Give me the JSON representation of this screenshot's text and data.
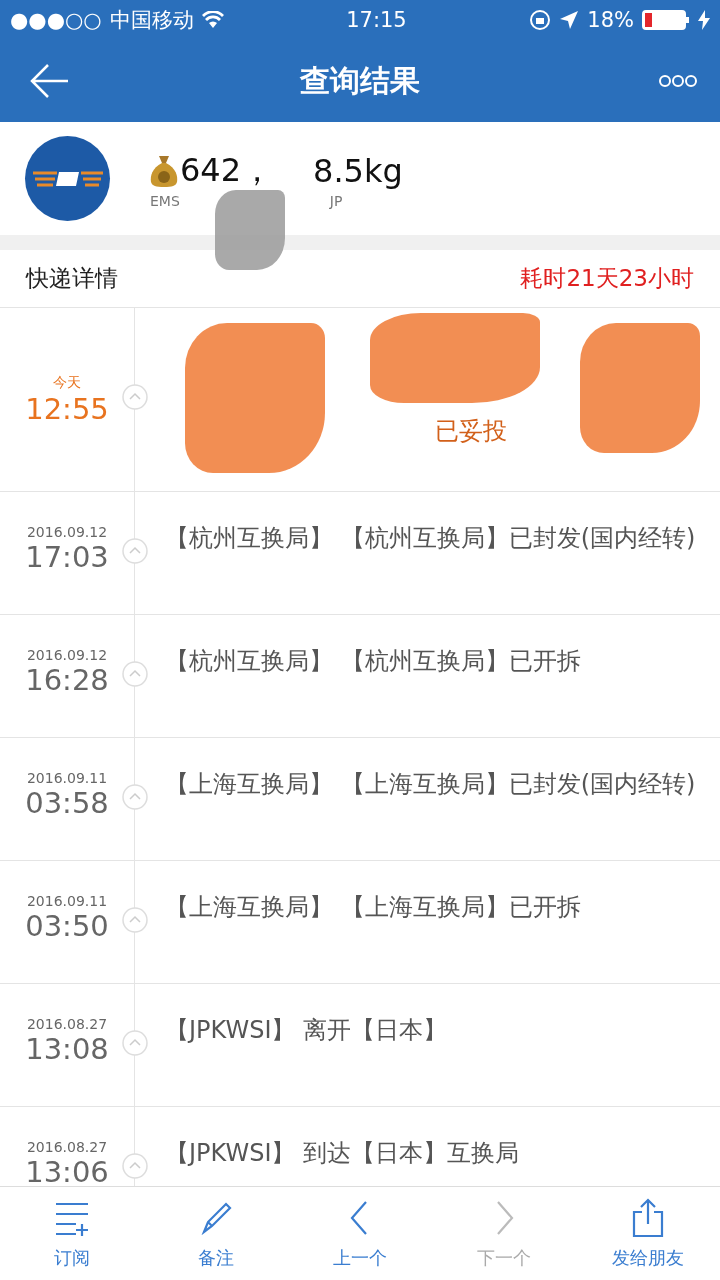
{
  "status_bar": {
    "signal_dots": "●●●○○",
    "carrier": "中国移动",
    "time": "17:15",
    "battery": "18%"
  },
  "nav": {
    "title": "查询结果"
  },
  "package": {
    "price": "642，",
    "weight": "8.5kg",
    "code_start": "EMS",
    "code_end": "JP"
  },
  "section": {
    "title": "快递详情",
    "elapsed": "耗时21天23小时"
  },
  "events": [
    {
      "date": "今天",
      "time": "12:55",
      "text": "已妥投",
      "latest": true
    },
    {
      "date": "2016.09.12",
      "time": "17:03",
      "text": "【杭州互换局】 【杭州互换局】已封发(国内经转)",
      "latest": false
    },
    {
      "date": "2016.09.12",
      "time": "16:28",
      "text": "【杭州互换局】 【杭州互换局】已开拆",
      "latest": false
    },
    {
      "date": "2016.09.11",
      "time": "03:58",
      "text": "【上海互换局】 【上海互换局】已封发(国内经转)",
      "latest": false
    },
    {
      "date": "2016.09.11",
      "time": "03:50",
      "text": "【上海互换局】 【上海互换局】已开拆",
      "latest": false
    },
    {
      "date": "2016.08.27",
      "time": "13:08",
      "text": "【JPKWSI】 离开【日本】",
      "latest": false
    },
    {
      "date": "2016.08.27",
      "time": "13:06",
      "text": "【JPKWSI】 到达【日本】互换局",
      "latest": false
    }
  ],
  "toolbar": [
    {
      "kind": "subscribe",
      "label": "订阅",
      "disabled": false
    },
    {
      "kind": "note",
      "label": "备注",
      "disabled": false
    },
    {
      "kind": "prev",
      "label": "上一个",
      "disabled": false
    },
    {
      "kind": "next",
      "label": "下一个",
      "disabled": true
    },
    {
      "kind": "share",
      "label": "发给朋友",
      "disabled": false
    }
  ]
}
